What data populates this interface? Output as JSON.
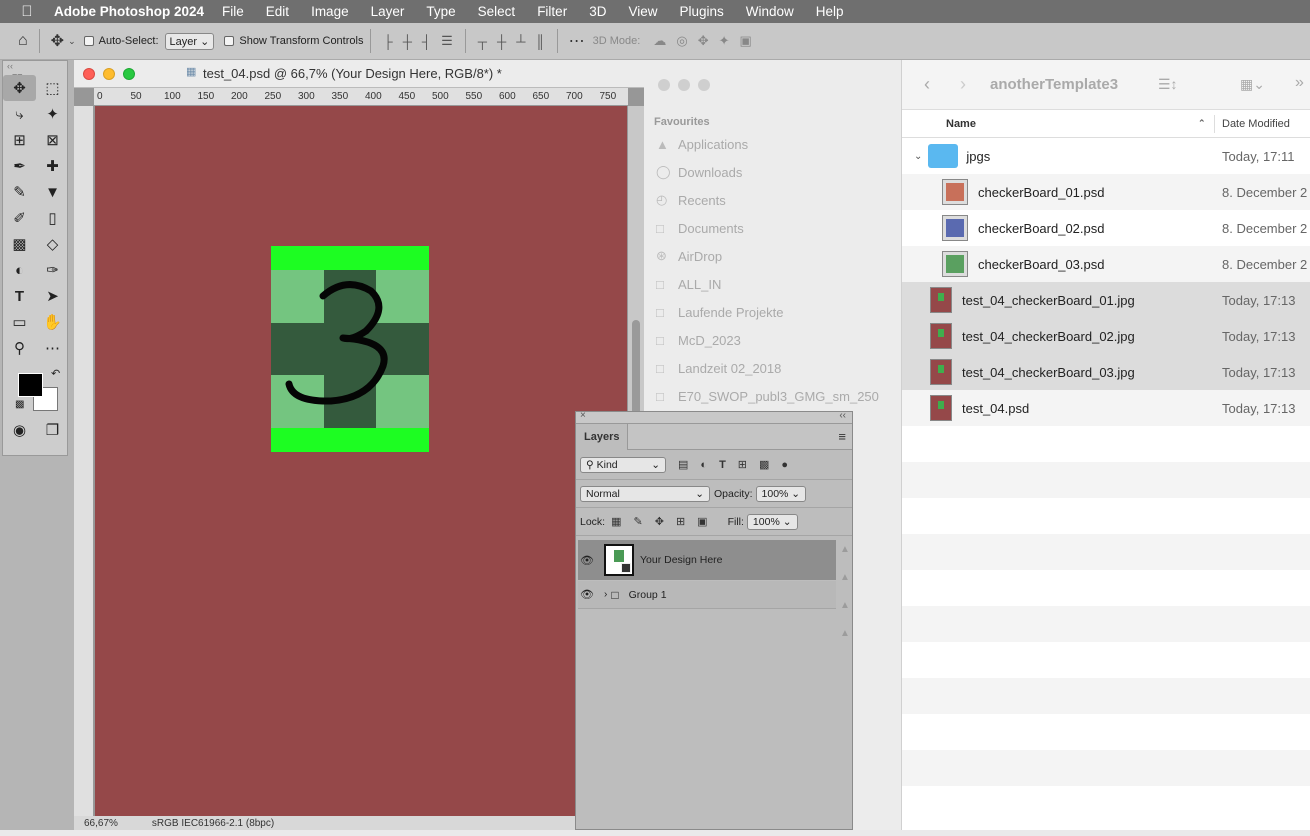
{
  "menubar": {
    "app": "Adobe Photoshop 2024",
    "items": [
      "File",
      "Edit",
      "Image",
      "Layer",
      "Type",
      "Select",
      "Filter",
      "3D",
      "View",
      "Plugins",
      "Window",
      "Help"
    ]
  },
  "options": {
    "auto_select_label": "Auto-Select:",
    "auto_select_value": "Layer",
    "transform_label": "Show Transform Controls",
    "mode_label": "3D Mode:"
  },
  "document": {
    "title": "test_04.psd @ 66,7% (Your Design Here, RGB/8*) *",
    "ruler_ticks": [
      "0",
      "50",
      "100",
      "150",
      "200",
      "250",
      "300",
      "350",
      "400",
      "450",
      "500",
      "550",
      "600",
      "650",
      "700",
      "750"
    ],
    "zoom": "66,67%",
    "profile": "sRGB IEC61966-2.1 (8bpc)",
    "design_glyph": "3",
    "colors": {
      "canvas": "#954849",
      "bar": "#1dfd22",
      "light": "#74c580",
      "dark": "#345a3d"
    }
  },
  "layers": {
    "tab": "Layers",
    "filter": "Kind",
    "blend": "Normal",
    "opacity_label": "Opacity:",
    "opacity": "100%",
    "lock_label": "Lock:",
    "fill_label": "Fill:",
    "fill": "100%",
    "items": [
      {
        "name": "Your Design Here",
        "selected": true
      },
      {
        "name": "Group 1",
        "selected": false
      }
    ]
  },
  "finder": {
    "title": "anotherTemplate3",
    "favourites_label": "Favourites",
    "sidebar": [
      "Applications",
      "Downloads",
      "Recents",
      "Documents",
      "AirDrop",
      "ALL_IN",
      "Laufende Projekte",
      "McD_2023",
      "Landzeit 02_2018",
      "E70_SWOP_publ3_GMG_sm_250"
    ],
    "col_name": "Name",
    "col_date": "Date Modified",
    "files": [
      {
        "name": "jpgs",
        "date": "Today, 17:11",
        "type": "folder"
      },
      {
        "name": "checkerBoard_01.psd",
        "date": "8. December 2",
        "type": "child",
        "accent": "#c8705a"
      },
      {
        "name": "checkerBoard_02.psd",
        "date": "8. December 2",
        "type": "child",
        "accent": "#5a6ab0"
      },
      {
        "name": "checkerBoard_03.psd",
        "date": "8. December 2",
        "type": "child",
        "accent": "#5aa060"
      },
      {
        "name": "test_04_checkerBoard_01.jpg",
        "date": "Today, 17:13",
        "type": "file"
      },
      {
        "name": "test_04_checkerBoard_02.jpg",
        "date": "Today, 17:13",
        "type": "file"
      },
      {
        "name": "test_04_checkerBoard_03.jpg",
        "date": "Today, 17:13",
        "type": "file"
      },
      {
        "name": "test_04.psd",
        "date": "Today, 17:13",
        "type": "file"
      }
    ]
  }
}
